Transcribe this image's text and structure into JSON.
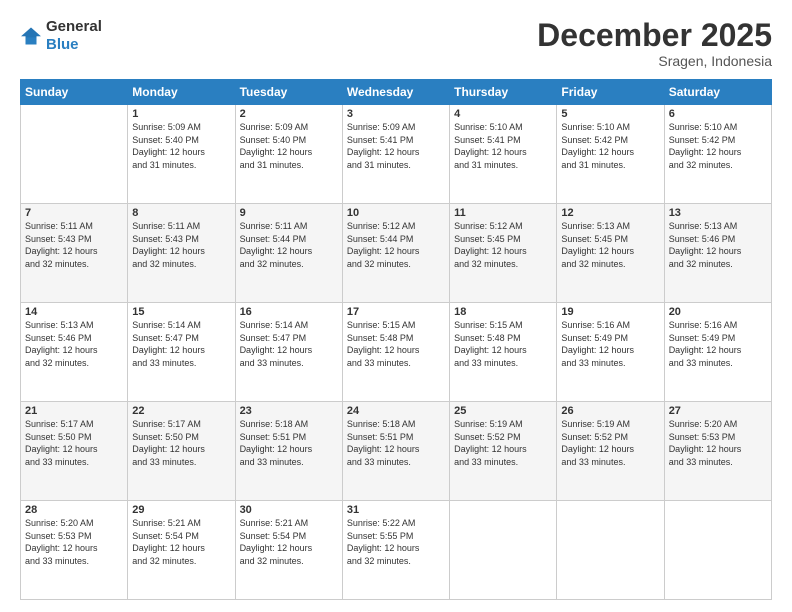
{
  "logo": {
    "general": "General",
    "blue": "Blue"
  },
  "header": {
    "month": "December 2025",
    "location": "Sragen, Indonesia"
  },
  "weekdays": [
    "Sunday",
    "Monday",
    "Tuesday",
    "Wednesday",
    "Thursday",
    "Friday",
    "Saturday"
  ],
  "weeks": [
    [
      {
        "day": "",
        "info": ""
      },
      {
        "day": "1",
        "info": "Sunrise: 5:09 AM\nSunset: 5:40 PM\nDaylight: 12 hours\nand 31 minutes."
      },
      {
        "day": "2",
        "info": "Sunrise: 5:09 AM\nSunset: 5:40 PM\nDaylight: 12 hours\nand 31 minutes."
      },
      {
        "day": "3",
        "info": "Sunrise: 5:09 AM\nSunset: 5:41 PM\nDaylight: 12 hours\nand 31 minutes."
      },
      {
        "day": "4",
        "info": "Sunrise: 5:10 AM\nSunset: 5:41 PM\nDaylight: 12 hours\nand 31 minutes."
      },
      {
        "day": "5",
        "info": "Sunrise: 5:10 AM\nSunset: 5:42 PM\nDaylight: 12 hours\nand 31 minutes."
      },
      {
        "day": "6",
        "info": "Sunrise: 5:10 AM\nSunset: 5:42 PM\nDaylight: 12 hours\nand 32 minutes."
      }
    ],
    [
      {
        "day": "7",
        "info": "Sunrise: 5:11 AM\nSunset: 5:43 PM\nDaylight: 12 hours\nand 32 minutes."
      },
      {
        "day": "8",
        "info": "Sunrise: 5:11 AM\nSunset: 5:43 PM\nDaylight: 12 hours\nand 32 minutes."
      },
      {
        "day": "9",
        "info": "Sunrise: 5:11 AM\nSunset: 5:44 PM\nDaylight: 12 hours\nand 32 minutes."
      },
      {
        "day": "10",
        "info": "Sunrise: 5:12 AM\nSunset: 5:44 PM\nDaylight: 12 hours\nand 32 minutes."
      },
      {
        "day": "11",
        "info": "Sunrise: 5:12 AM\nSunset: 5:45 PM\nDaylight: 12 hours\nand 32 minutes."
      },
      {
        "day": "12",
        "info": "Sunrise: 5:13 AM\nSunset: 5:45 PM\nDaylight: 12 hours\nand 32 minutes."
      },
      {
        "day": "13",
        "info": "Sunrise: 5:13 AM\nSunset: 5:46 PM\nDaylight: 12 hours\nand 32 minutes."
      }
    ],
    [
      {
        "day": "14",
        "info": "Sunrise: 5:13 AM\nSunset: 5:46 PM\nDaylight: 12 hours\nand 32 minutes."
      },
      {
        "day": "15",
        "info": "Sunrise: 5:14 AM\nSunset: 5:47 PM\nDaylight: 12 hours\nand 33 minutes."
      },
      {
        "day": "16",
        "info": "Sunrise: 5:14 AM\nSunset: 5:47 PM\nDaylight: 12 hours\nand 33 minutes."
      },
      {
        "day": "17",
        "info": "Sunrise: 5:15 AM\nSunset: 5:48 PM\nDaylight: 12 hours\nand 33 minutes."
      },
      {
        "day": "18",
        "info": "Sunrise: 5:15 AM\nSunset: 5:48 PM\nDaylight: 12 hours\nand 33 minutes."
      },
      {
        "day": "19",
        "info": "Sunrise: 5:16 AM\nSunset: 5:49 PM\nDaylight: 12 hours\nand 33 minutes."
      },
      {
        "day": "20",
        "info": "Sunrise: 5:16 AM\nSunset: 5:49 PM\nDaylight: 12 hours\nand 33 minutes."
      }
    ],
    [
      {
        "day": "21",
        "info": "Sunrise: 5:17 AM\nSunset: 5:50 PM\nDaylight: 12 hours\nand 33 minutes."
      },
      {
        "day": "22",
        "info": "Sunrise: 5:17 AM\nSunset: 5:50 PM\nDaylight: 12 hours\nand 33 minutes."
      },
      {
        "day": "23",
        "info": "Sunrise: 5:18 AM\nSunset: 5:51 PM\nDaylight: 12 hours\nand 33 minutes."
      },
      {
        "day": "24",
        "info": "Sunrise: 5:18 AM\nSunset: 5:51 PM\nDaylight: 12 hours\nand 33 minutes."
      },
      {
        "day": "25",
        "info": "Sunrise: 5:19 AM\nSunset: 5:52 PM\nDaylight: 12 hours\nand 33 minutes."
      },
      {
        "day": "26",
        "info": "Sunrise: 5:19 AM\nSunset: 5:52 PM\nDaylight: 12 hours\nand 33 minutes."
      },
      {
        "day": "27",
        "info": "Sunrise: 5:20 AM\nSunset: 5:53 PM\nDaylight: 12 hours\nand 33 minutes."
      }
    ],
    [
      {
        "day": "28",
        "info": "Sunrise: 5:20 AM\nSunset: 5:53 PM\nDaylight: 12 hours\nand 33 minutes."
      },
      {
        "day": "29",
        "info": "Sunrise: 5:21 AM\nSunset: 5:54 PM\nDaylight: 12 hours\nand 32 minutes."
      },
      {
        "day": "30",
        "info": "Sunrise: 5:21 AM\nSunset: 5:54 PM\nDaylight: 12 hours\nand 32 minutes."
      },
      {
        "day": "31",
        "info": "Sunrise: 5:22 AM\nSunset: 5:55 PM\nDaylight: 12 hours\nand 32 minutes."
      },
      {
        "day": "",
        "info": ""
      },
      {
        "day": "",
        "info": ""
      },
      {
        "day": "",
        "info": ""
      }
    ]
  ]
}
